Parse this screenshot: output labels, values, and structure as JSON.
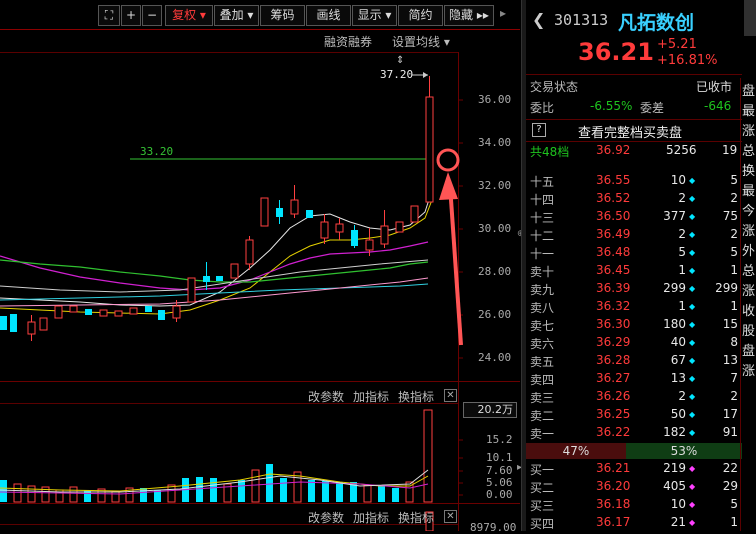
{
  "toolbar": {
    "fuquan": "复权",
    "diejia": "叠加",
    "chouma": "筹码",
    "huaxian": "画线",
    "xianshi": "显示",
    "jianyue": "简约",
    "yincang": "隐藏",
    "rongzi": "融资融券",
    "junxian": "设置均线"
  },
  "chart": {
    "high_label": "37.20",
    "ref_line_label": "33.20",
    "price_axis": [
      "36.00",
      "34.00",
      "32.00",
      "30.00",
      "28.00",
      "26.00",
      "24.00"
    ],
    "indicator_bar": [
      "改参数",
      "加指标",
      "换指标"
    ],
    "volume_box": "20.2万",
    "vol_axis": [
      "15.2",
      "10.1",
      "7.60",
      "5.06",
      "0.00"
    ],
    "bottom_value": "8979.00"
  },
  "quote": {
    "code": "301313",
    "name": "凡拓数创",
    "price": "36.21",
    "change": "+5.21",
    "change_pct": "+16.81%",
    "status_label": "交易状态",
    "status_value": "已收市",
    "weibi_label": "委比",
    "weibi_value": "-6.55%",
    "weicha_label": "委差",
    "weicha_value": "-646",
    "depth_button": "查看完整档买卖盘",
    "total_label": "共48档",
    "total_price": "36.92",
    "total_vol": "5256",
    "total_cnt": "19",
    "asks": [
      {
        "label": "十五",
        "price": "36.55",
        "vol": "10",
        "cnt": "5"
      },
      {
        "label": "十四",
        "price": "36.52",
        "vol": "2",
        "cnt": "2"
      },
      {
        "label": "十三",
        "price": "36.50",
        "vol": "377",
        "cnt": "75"
      },
      {
        "label": "十二",
        "price": "36.49",
        "vol": "2",
        "cnt": "2"
      },
      {
        "label": "十一",
        "price": "36.48",
        "vol": "5",
        "cnt": "5"
      },
      {
        "label": "卖十",
        "price": "36.45",
        "vol": "1",
        "cnt": "1"
      },
      {
        "label": "卖九",
        "price": "36.39",
        "vol": "299",
        "cnt": "299"
      },
      {
        "label": "卖八",
        "price": "36.32",
        "vol": "1",
        "cnt": "1"
      },
      {
        "label": "卖七",
        "price": "36.30",
        "vol": "180",
        "cnt": "15"
      },
      {
        "label": "卖六",
        "price": "36.29",
        "vol": "40",
        "cnt": "8"
      },
      {
        "label": "卖五",
        "price": "36.28",
        "vol": "67",
        "cnt": "13"
      },
      {
        "label": "卖四",
        "price": "36.27",
        "vol": "13",
        "cnt": "7"
      },
      {
        "label": "卖三",
        "price": "36.26",
        "vol": "2",
        "cnt": "2"
      },
      {
        "label": "卖二",
        "price": "36.25",
        "vol": "50",
        "cnt": "17"
      },
      {
        "label": "卖一",
        "price": "36.22",
        "vol": "182",
        "cnt": "91"
      }
    ],
    "ratio_sell": "47%",
    "ratio_buy": "53%",
    "bids": [
      {
        "label": "买一",
        "price": "36.21",
        "vol": "219",
        "cnt": "22"
      },
      {
        "label": "买二",
        "price": "36.20",
        "vol": "405",
        "cnt": "29"
      },
      {
        "label": "买三",
        "price": "36.18",
        "vol": "10",
        "cnt": "5"
      },
      {
        "label": "买四",
        "price": "36.17",
        "vol": "21",
        "cnt": "1"
      }
    ],
    "right_cut": [
      "盘",
      "最",
      "涨",
      "总",
      "换",
      "最",
      "今",
      "涨",
      "外",
      "总",
      "涨",
      "收",
      "股",
      "盘",
      "涨"
    ]
  }
}
